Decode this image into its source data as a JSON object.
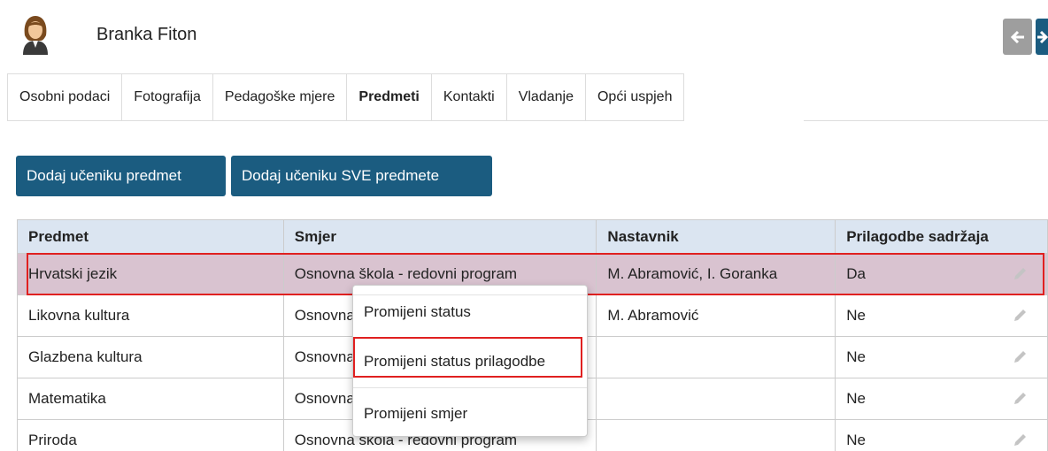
{
  "student": {
    "name": "Branka Fiton",
    "avatar_icon": "female-user-icon"
  },
  "nav": {
    "prev_icon": "arrow-left-icon",
    "next_icon": "arrow-right-icon"
  },
  "tabs": [
    {
      "label": "Osobni podaci",
      "active": false
    },
    {
      "label": "Fotografija",
      "active": false
    },
    {
      "label": "Pedagoške mjere",
      "active": false
    },
    {
      "label": "Predmeti",
      "active": true
    },
    {
      "label": "Kontakti",
      "active": false
    },
    {
      "label": "Vladanje",
      "active": false
    },
    {
      "label": "Opći uspjeh",
      "active": false
    }
  ],
  "buttons": {
    "add_subject": "Dodaj učeniku predmet",
    "add_all_subjects": "Dodaj učeniku SVE predmete"
  },
  "table": {
    "headers": [
      "Predmet",
      "Smjer",
      "Nastavnik",
      "Prilagodbe sadržaja"
    ],
    "rows": [
      {
        "subject": "Hrvatski jezik",
        "program": "Osnovna škola - redovni program",
        "teacher": "M. Abramović, I. Goranka",
        "adjustment": "Da",
        "selected": true
      },
      {
        "subject": "Likovna kultura",
        "program": "Osnovna škola - redovni program",
        "teacher": "M. Abramović",
        "adjustment": "Ne",
        "selected": false
      },
      {
        "subject": "Glazbena kultura",
        "program": "Osnovna škola - redovni program",
        "teacher": "",
        "adjustment": "Ne",
        "selected": false
      },
      {
        "subject": "Matematika",
        "program": "Osnovna škola - redovni program",
        "teacher": "",
        "adjustment": "Ne",
        "selected": false
      },
      {
        "subject": "Priroda",
        "program": "Osnovna škola - redovni program",
        "teacher": "",
        "adjustment": "Ne",
        "selected": false
      }
    ]
  },
  "context_menu": {
    "items": [
      "Promijeni status",
      "Promijeni status prilagodbe",
      "Promijeni smjer"
    ],
    "highlighted_index": 1
  },
  "colors": {
    "primary": "#1b5c80",
    "selected_row": "#d9c3d0",
    "highlight_border": "#e02020",
    "header_bg": "#dbe5f1"
  }
}
